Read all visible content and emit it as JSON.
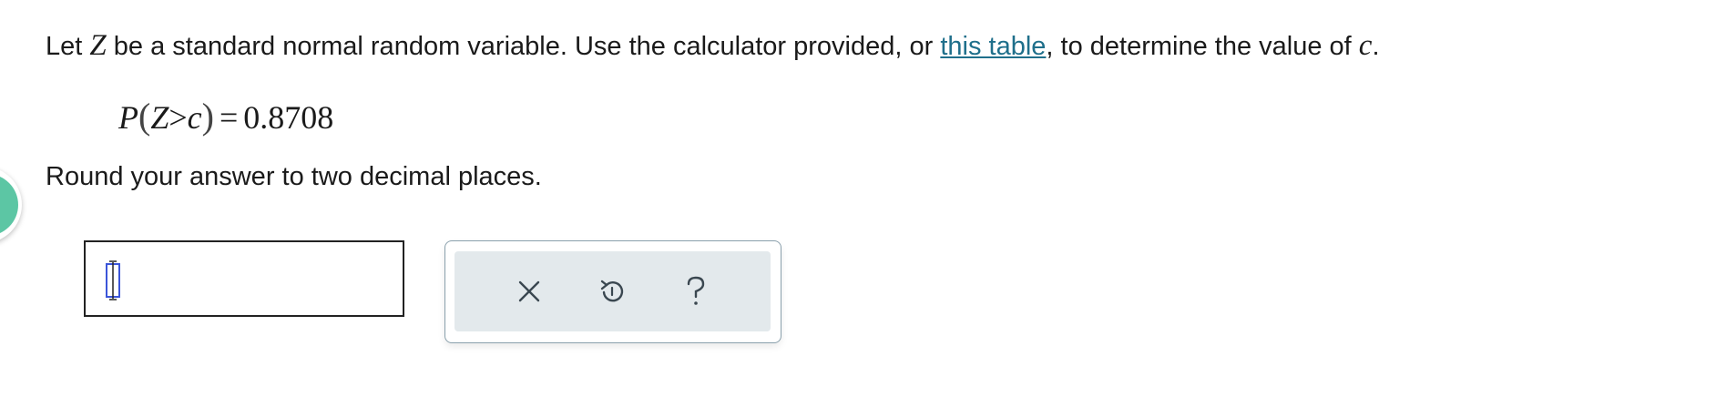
{
  "prompt": {
    "text_before_z": "Let ",
    "var_z": "Z",
    "text_mid": " be a standard normal random variable. Use the calculator provided, or ",
    "link_text": "this table",
    "text_after_link": ", to determine the value of ",
    "var_c": "c",
    "text_end": "."
  },
  "equation": {
    "p": "P",
    "open_paren": "(",
    "z": "Z",
    "op": ">",
    "c": "c",
    "close_paren": ")",
    "eq": "=",
    "value": "0.8708"
  },
  "instruction": "Round your answer to two decimal places.",
  "answer": {
    "value": "",
    "cursor_icon": "text-cursor-icon"
  },
  "toolbar": {
    "clear_icon": "x-icon",
    "undo_icon": "undo-icon",
    "help_icon": "question-mark-icon"
  },
  "colors": {
    "link": "#1f6f8b",
    "tab_accent": "#5cc6a4",
    "toolbar_bg": "#e3e9ec",
    "toolbar_border": "#8aa0ac",
    "cursor_blue": "#3b55d9"
  }
}
